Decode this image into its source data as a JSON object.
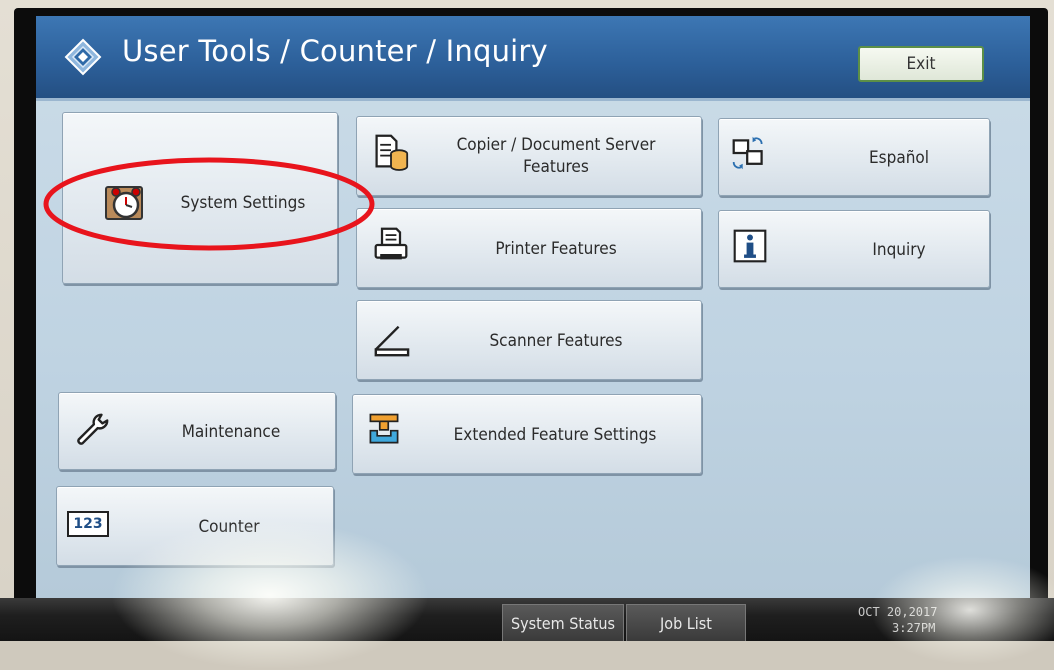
{
  "header": {
    "title": "User Tools / Counter / Inquiry",
    "exit_label": "Exit"
  },
  "buttons": {
    "system_settings": "System Settings",
    "copier_line1": "Copier / Document Server",
    "copier_line2": "Features",
    "espanol": "Español",
    "printer": "Printer Features",
    "inquiry": "Inquiry",
    "scanner": "Scanner Features",
    "maintenance": "Maintenance",
    "extended": "Extended Feature Settings",
    "counter": "Counter",
    "counter_icon_text": "123"
  },
  "footer": {
    "system_status": "System Status",
    "job_list": "Job List",
    "date": "OCT  20,2017",
    "time": "3:27PM"
  },
  "colors": {
    "title_bar": "#2c5f99",
    "panel": "#c4d7e5",
    "exit_border": "#5c8f47",
    "annotation": "#e8141c"
  }
}
